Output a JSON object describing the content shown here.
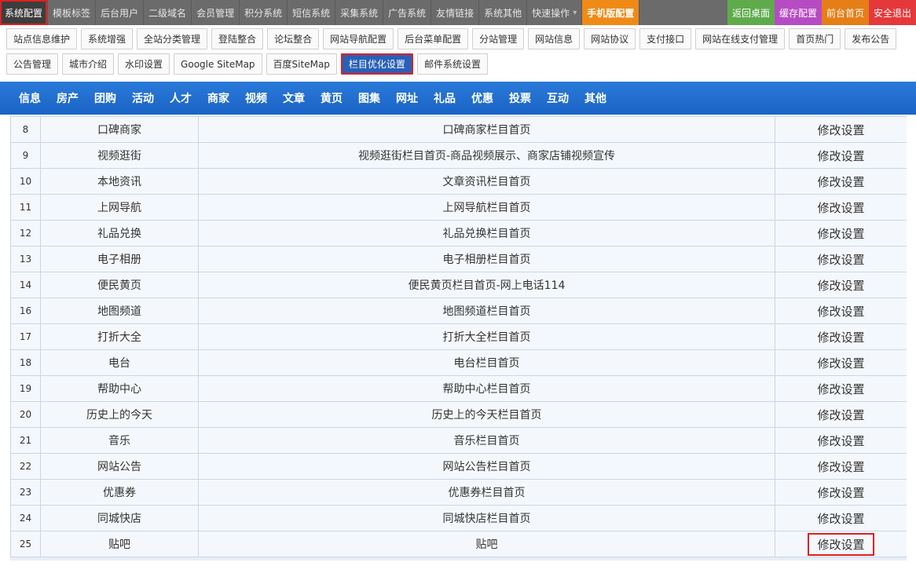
{
  "topbar": {
    "tabs": [
      {
        "label": "系统配置",
        "active": true
      },
      {
        "label": "模板标签"
      },
      {
        "label": "后台用户"
      },
      {
        "label": "二级域名"
      },
      {
        "label": "会员管理"
      },
      {
        "label": "积分系统"
      },
      {
        "label": "短信系统"
      },
      {
        "label": "采集系统"
      },
      {
        "label": "广告系统"
      },
      {
        "label": "友情链接"
      },
      {
        "label": "系统其他"
      },
      {
        "label": "快速操作"
      },
      {
        "label": "手机版配置"
      }
    ],
    "right": [
      {
        "label": "返回桌面",
        "color": "#5fab4c"
      },
      {
        "label": "缓存配置",
        "color": "#b74bc4"
      },
      {
        "label": "前台首页",
        "color": "#e67e17"
      },
      {
        "label": "安全退出",
        "color": "#e5383b"
      }
    ]
  },
  "subnav": {
    "row1": [
      "站点信息维护",
      "系统增强",
      "全站分类管理",
      "登陆整合",
      "论坛整合",
      "网站导航配置",
      "后台菜单配置",
      "分站管理",
      "网站信息",
      "网站协议",
      "支付接口",
      "网站在线支付管理",
      "首页热门",
      "发布公告"
    ],
    "row2": [
      "公告管理",
      "城市介绍",
      "水印设置",
      "Google SiteMap",
      "百度SiteMap",
      "栏目优化设置",
      "邮件系统设置"
    ]
  },
  "categories": [
    "信息",
    "房产",
    "团购",
    "活动",
    "人才",
    "商家",
    "视频",
    "文章",
    "黄页",
    "图集",
    "网址",
    "礼品",
    "优惠",
    "投票",
    "互动",
    "其他"
  ],
  "table": {
    "action_label": "修改设置",
    "rows": [
      {
        "id": "8",
        "name": "口碑商家",
        "title": "口碑商家栏目首页"
      },
      {
        "id": "9",
        "name": "视频逛街",
        "title": "视频逛街栏目首页-商品视频展示、商家店铺视频宣传"
      },
      {
        "id": "10",
        "name": "本地资讯",
        "title": "文章资讯栏目首页"
      },
      {
        "id": "11",
        "name": "上网导航",
        "title": "上网导航栏目首页"
      },
      {
        "id": "12",
        "name": "礼品兑换",
        "title": "礼品兑换栏目首页"
      },
      {
        "id": "13",
        "name": "电子相册",
        "title": "电子相册栏目首页"
      },
      {
        "id": "14",
        "name": "便民黄页",
        "title": "便民黄页栏目首页-网上电话114"
      },
      {
        "id": "16",
        "name": "地图频道",
        "title": "地图频道栏目首页"
      },
      {
        "id": "17",
        "name": "打折大全",
        "title": "打折大全栏目首页"
      },
      {
        "id": "18",
        "name": "电台",
        "title": "电台栏目首页"
      },
      {
        "id": "19",
        "name": "帮助中心",
        "title": "帮助中心栏目首页"
      },
      {
        "id": "20",
        "name": "历史上的今天",
        "title": "历史上的今天栏目首页"
      },
      {
        "id": "21",
        "name": "音乐",
        "title": "音乐栏目首页"
      },
      {
        "id": "22",
        "name": "网站公告",
        "title": "网站公告栏目首页"
      },
      {
        "id": "23",
        "name": "优惠券",
        "title": "优惠券栏目首页"
      },
      {
        "id": "24",
        "name": "同城快店",
        "title": "同城快店栏目首页"
      },
      {
        "id": "25",
        "name": "贴吧",
        "title": "贴吧"
      }
    ]
  }
}
